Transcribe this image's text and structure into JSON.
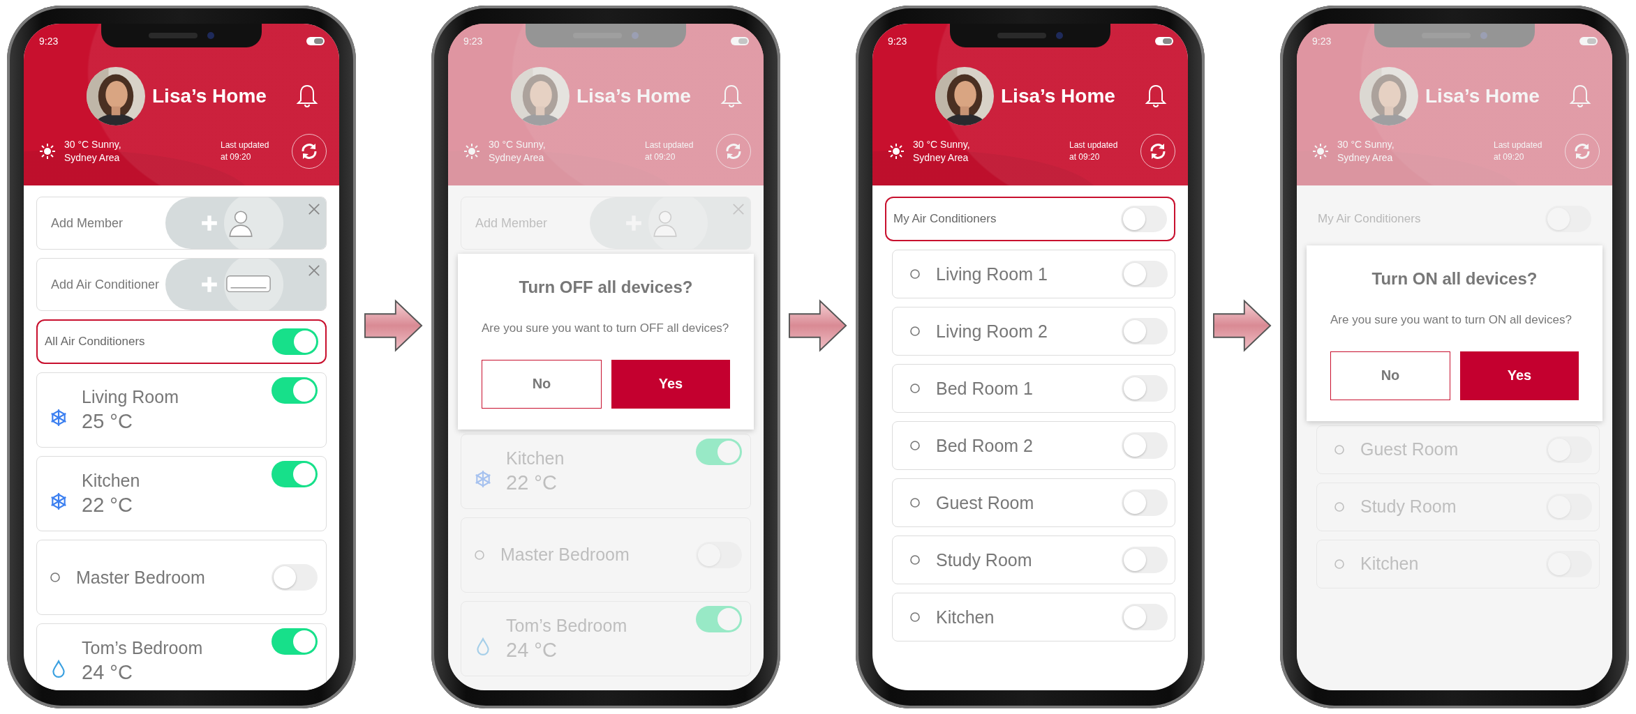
{
  "screens": [
    {
      "dimmed": false,
      "header": {
        "time": "9:23",
        "title": "Lisa’s Home",
        "weather": "30 °C Sunny, Sydney Area",
        "updated": "Last updated at 09:20"
      },
      "items": [
        {
          "kind": "member",
          "label": "Add Member"
        },
        {
          "kind": "appliance",
          "label": "Add Air Conditioner"
        },
        {
          "kind": "master",
          "label": "All Air Conditioners",
          "on": true,
          "highlighted": true
        },
        {
          "kind": "cooling",
          "label": "Living Room",
          "temp": "25 °C",
          "on": true
        },
        {
          "kind": "cooling",
          "label": "Kitchen",
          "temp": "22 °C",
          "on": true
        },
        {
          "kind": "idle",
          "label": "Master Bedroom",
          "on": false
        },
        {
          "kind": "drying",
          "label": "Tom’s Bedroom",
          "temp": "24 °C",
          "on": true
        }
      ]
    },
    {
      "dimmed": true,
      "header": {
        "time": "9:23",
        "title": "Lisa’s Home",
        "weather": "30 °C Sunny, Sydney Area",
        "updated": "Last updated at 09:20"
      },
      "items": [
        {
          "kind": "member",
          "label": "Add Member"
        },
        {
          "kind": "dialog",
          "title": "Turn OFF all devices?",
          "message": "Are you sure you want to turn OFF all devices?",
          "buttons": [
            {
              "label": "No",
              "kind": "secondary"
            },
            {
              "label": "Yes",
              "kind": "primary"
            }
          ]
        },
        {
          "kind": "cooling",
          "label": "Kitchen",
          "temp": "22 °C",
          "on": true
        },
        {
          "kind": "idle",
          "label": "Master Bedroom",
          "on": false
        },
        {
          "kind": "drying",
          "label": "Tom’s Bedroom",
          "temp": "24 °C",
          "on": true
        }
      ]
    },
    {
      "dimmed": false,
      "header": {
        "time": "9:23",
        "title": "Lisa’s Home",
        "weather": "30 °C Sunny, Sydney Area",
        "updated": "Last updated at 09:20"
      },
      "items": [
        {
          "kind": "master",
          "label": "My Air Conditioners",
          "on": false,
          "highlighted": true
        },
        {
          "kind": "room",
          "label": "Living Room 1",
          "on": false
        },
        {
          "kind": "room",
          "label": "Living Room 2",
          "on": false
        },
        {
          "kind": "room",
          "label": "Bed Room 1",
          "on": false
        },
        {
          "kind": "room",
          "label": "Bed Room 2",
          "on": false
        },
        {
          "kind": "room",
          "label": "Guest Room",
          "on": false
        },
        {
          "kind": "room",
          "label": "Study Room",
          "on": false
        },
        {
          "kind": "room",
          "label": "Kitchen",
          "on": false
        }
      ]
    },
    {
      "dimmed": true,
      "header": {
        "time": "9:23",
        "title": "Lisa’s Home",
        "weather": "30 °C Sunny, Sydney Area",
        "updated": "Last updated at 09:20"
      },
      "items": [
        {
          "kind": "master",
          "label": "My Air Conditioners",
          "on": false,
          "highlighted": false
        },
        {
          "kind": "dialog",
          "title": "Turn ON all devices?",
          "message": "Are you sure you want to turn ON all devices?",
          "buttons": [
            {
              "label": "No",
              "kind": "secondary"
            },
            {
              "label": "Yes",
              "kind": "primary"
            }
          ]
        },
        {
          "kind": "room",
          "label": "Guest Room",
          "on": false
        },
        {
          "kind": "room",
          "label": "Study Room",
          "on": false
        },
        {
          "kind": "room",
          "label": "Kitchen",
          "on": false
        }
      ]
    }
  ]
}
